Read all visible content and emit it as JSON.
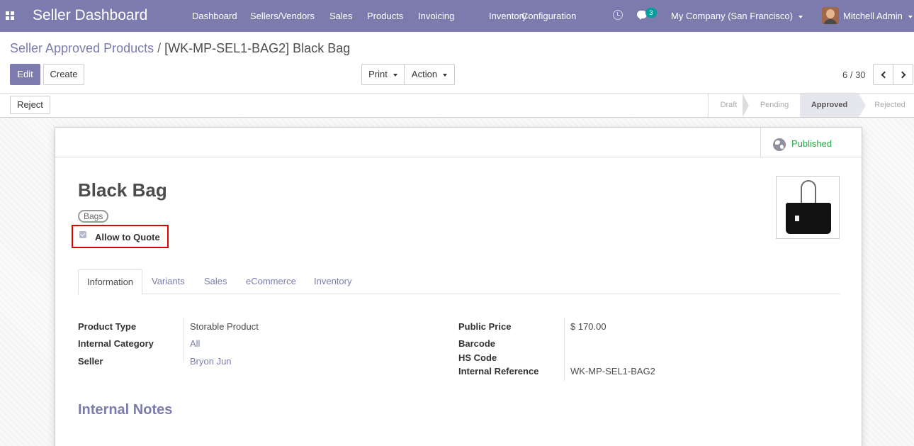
{
  "app": {
    "brand": "Seller Dashboard",
    "menu": [
      "Dashboard",
      "Sellers/Vendors",
      "Sales",
      "Products",
      "Invoicing",
      "Inventory",
      "Configuration"
    ],
    "notification_count": "3",
    "company": "My Company (San Francisco)",
    "user": "Mitchell Admin"
  },
  "breadcrumb": {
    "parent": "Seller Approved Products",
    "separator": "/",
    "current": "[WK-MP-SEL1-BAG2] Black Bag"
  },
  "toolbar": {
    "edit_label": "Edit",
    "create_label": "Create",
    "print_label": "Print",
    "action_label": "Action",
    "pager_text": "6 / 30"
  },
  "statusbar": {
    "reject_label": "Reject",
    "stages": [
      "Draft",
      "Pending",
      "Approved",
      "Rejected"
    ],
    "active_stage": "Approved"
  },
  "form": {
    "published_label": "Published",
    "product_name": "Black Bag",
    "tag": "Bags",
    "allow_quote_label": "Allow to Quote",
    "allow_quote_checked": true,
    "tabs": [
      "Information",
      "Variants",
      "Sales",
      "eCommerce",
      "Inventory"
    ],
    "active_tab": "Information",
    "left_fields": [
      {
        "label": "Product Type",
        "value": "Storable Product"
      },
      {
        "label": "Internal Category",
        "value": "All"
      },
      {
        "label": "Seller",
        "value": "Bryon Jun"
      }
    ],
    "right_fields": [
      {
        "label": "Public Price",
        "value": "$ 170.00"
      },
      {
        "label": "Barcode",
        "value": ""
      },
      {
        "label": "HS Code",
        "value": ""
      },
      {
        "label": "Internal Reference",
        "value": "WK-MP-SEL1-BAG2"
      }
    ],
    "notes_heading": "Internal Notes"
  },
  "colors": {
    "primary": "#7c7bad",
    "published": "#28a745",
    "highlight": "#e10000"
  }
}
